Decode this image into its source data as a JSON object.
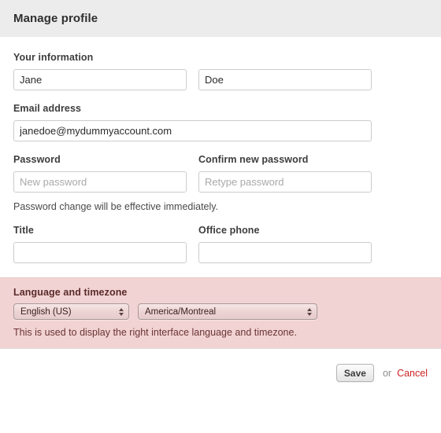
{
  "header": {
    "title": "Manage profile",
    "background_color": "#ececec"
  },
  "form": {
    "your_information": {
      "label": "Your information",
      "first_name": {
        "value": "Jane",
        "placeholder": ""
      },
      "last_name": {
        "value": "Doe",
        "placeholder": ""
      }
    },
    "email": {
      "label": "Email address",
      "value": "janedoe@mydummyaccount.com",
      "placeholder": ""
    },
    "password": {
      "label": "Password",
      "value": "",
      "placeholder": "New password"
    },
    "confirm_password": {
      "label": "Confirm new password",
      "value": "",
      "placeholder": "Retype password"
    },
    "password_help": "Password change will be effective immediately.",
    "title_field": {
      "label": "Title",
      "value": "",
      "placeholder": ""
    },
    "office_phone": {
      "label": "Office phone",
      "value": "",
      "placeholder": ""
    }
  },
  "language_timezone": {
    "label": "Language and timezone",
    "background_color": "#f2d3d3",
    "language_select": {
      "selected": "English (US)",
      "icon": "stepper-updown-icon"
    },
    "timezone_select": {
      "selected": "America/Montreal",
      "icon": "stepper-updown-icon"
    },
    "help_text": "This is used to display the right interface language and timezone."
  },
  "footer": {
    "save_label": "Save",
    "or_label": "or",
    "cancel_label": "Cancel",
    "cancel_color": "#cc2222"
  }
}
